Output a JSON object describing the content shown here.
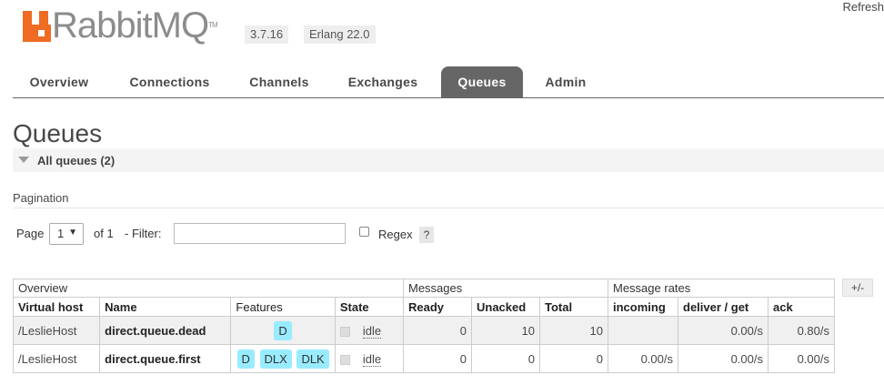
{
  "app": {
    "logo_text": "RabbitMQ",
    "logo_tm": "TM",
    "version": "3.7.16",
    "erlang": "Erlang 22.0",
    "refresh_label": "Refresh",
    "accent": "#f06b23"
  },
  "tabs": [
    {
      "label": "Overview",
      "active": false
    },
    {
      "label": "Connections",
      "active": false
    },
    {
      "label": "Channels",
      "active": false
    },
    {
      "label": "Exchanges",
      "active": false
    },
    {
      "label": "Queues",
      "active": true
    },
    {
      "label": "Admin",
      "active": false
    }
  ],
  "page": {
    "title": "Queues",
    "section_label": "All queues (2)"
  },
  "pagination": {
    "label": "Pagination",
    "page_label": "Page",
    "page_value": "1",
    "of_label": "of 1",
    "filter_label": "- Filter:",
    "filter_value": "",
    "regex_label": "Regex",
    "regex_checked": false,
    "help_label": "?"
  },
  "table": {
    "groups": [
      "Overview",
      "Messages",
      "Message rates"
    ],
    "plus_minus": "+/-",
    "columns": [
      "Virtual host",
      "Name",
      "Features",
      "State",
      "Ready",
      "Unacked",
      "Total",
      "incoming",
      "deliver / get",
      "ack"
    ],
    "rows": [
      {
        "vhost": "/LeslieHost",
        "name": "direct.queue.dead",
        "features": [
          "D"
        ],
        "state": "idle",
        "ready": "0",
        "unacked": "10",
        "total": "10",
        "incoming": "",
        "deliver_get": "0.00/s",
        "ack": "0.80/s"
      },
      {
        "vhost": "/LeslieHost",
        "name": "direct.queue.first",
        "features": [
          "D",
          "DLX",
          "DLK"
        ],
        "state": "idle",
        "ready": "0",
        "unacked": "0",
        "total": "0",
        "incoming": "0.00/s",
        "deliver_get": "0.00/s",
        "ack": "0.00/s"
      }
    ]
  }
}
